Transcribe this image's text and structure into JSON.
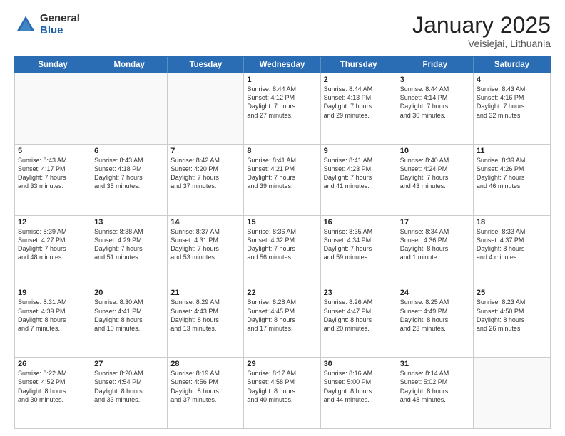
{
  "logo": {
    "general": "General",
    "blue": "Blue"
  },
  "header": {
    "month": "January 2025",
    "location": "Veisiejai, Lithuania"
  },
  "weekdays": [
    "Sunday",
    "Monday",
    "Tuesday",
    "Wednesday",
    "Thursday",
    "Friday",
    "Saturday"
  ],
  "rows": [
    [
      {
        "day": "",
        "sunrise": "",
        "sunset": "",
        "daylight": "",
        "empty": true
      },
      {
        "day": "",
        "sunrise": "",
        "sunset": "",
        "daylight": "",
        "empty": true
      },
      {
        "day": "",
        "sunrise": "",
        "sunset": "",
        "daylight": "",
        "empty": true
      },
      {
        "day": "1",
        "sunrise": "Sunrise: 8:44 AM",
        "sunset": "Sunset: 4:12 PM",
        "daylight": "Daylight: 7 hours and 27 minutes."
      },
      {
        "day": "2",
        "sunrise": "Sunrise: 8:44 AM",
        "sunset": "Sunset: 4:13 PM",
        "daylight": "Daylight: 7 hours and 29 minutes."
      },
      {
        "day": "3",
        "sunrise": "Sunrise: 8:44 AM",
        "sunset": "Sunset: 4:14 PM",
        "daylight": "Daylight: 7 hours and 30 minutes."
      },
      {
        "day": "4",
        "sunrise": "Sunrise: 8:43 AM",
        "sunset": "Sunset: 4:16 PM",
        "daylight": "Daylight: 7 hours and 32 minutes."
      }
    ],
    [
      {
        "day": "5",
        "sunrise": "Sunrise: 8:43 AM",
        "sunset": "Sunset: 4:17 PM",
        "daylight": "Daylight: 7 hours and 33 minutes."
      },
      {
        "day": "6",
        "sunrise": "Sunrise: 8:43 AM",
        "sunset": "Sunset: 4:18 PM",
        "daylight": "Daylight: 7 hours and 35 minutes."
      },
      {
        "day": "7",
        "sunrise": "Sunrise: 8:42 AM",
        "sunset": "Sunset: 4:20 PM",
        "daylight": "Daylight: 7 hours and 37 minutes."
      },
      {
        "day": "8",
        "sunrise": "Sunrise: 8:41 AM",
        "sunset": "Sunset: 4:21 PM",
        "daylight": "Daylight: 7 hours and 39 minutes."
      },
      {
        "day": "9",
        "sunrise": "Sunrise: 8:41 AM",
        "sunset": "Sunset: 4:23 PM",
        "daylight": "Daylight: 7 hours and 41 minutes."
      },
      {
        "day": "10",
        "sunrise": "Sunrise: 8:40 AM",
        "sunset": "Sunset: 4:24 PM",
        "daylight": "Daylight: 7 hours and 43 minutes."
      },
      {
        "day": "11",
        "sunrise": "Sunrise: 8:39 AM",
        "sunset": "Sunset: 4:26 PM",
        "daylight": "Daylight: 7 hours and 46 minutes."
      }
    ],
    [
      {
        "day": "12",
        "sunrise": "Sunrise: 8:39 AM",
        "sunset": "Sunset: 4:27 PM",
        "daylight": "Daylight: 7 hours and 48 minutes."
      },
      {
        "day": "13",
        "sunrise": "Sunrise: 8:38 AM",
        "sunset": "Sunset: 4:29 PM",
        "daylight": "Daylight: 7 hours and 51 minutes."
      },
      {
        "day": "14",
        "sunrise": "Sunrise: 8:37 AM",
        "sunset": "Sunset: 4:31 PM",
        "daylight": "Daylight: 7 hours and 53 minutes."
      },
      {
        "day": "15",
        "sunrise": "Sunrise: 8:36 AM",
        "sunset": "Sunset: 4:32 PM",
        "daylight": "Daylight: 7 hours and 56 minutes."
      },
      {
        "day": "16",
        "sunrise": "Sunrise: 8:35 AM",
        "sunset": "Sunset: 4:34 PM",
        "daylight": "Daylight: 7 hours and 59 minutes."
      },
      {
        "day": "17",
        "sunrise": "Sunrise: 8:34 AM",
        "sunset": "Sunset: 4:36 PM",
        "daylight": "Daylight: 8 hours and 1 minute."
      },
      {
        "day": "18",
        "sunrise": "Sunrise: 8:33 AM",
        "sunset": "Sunset: 4:37 PM",
        "daylight": "Daylight: 8 hours and 4 minutes."
      }
    ],
    [
      {
        "day": "19",
        "sunrise": "Sunrise: 8:31 AM",
        "sunset": "Sunset: 4:39 PM",
        "daylight": "Daylight: 8 hours and 7 minutes."
      },
      {
        "day": "20",
        "sunrise": "Sunrise: 8:30 AM",
        "sunset": "Sunset: 4:41 PM",
        "daylight": "Daylight: 8 hours and 10 minutes."
      },
      {
        "day": "21",
        "sunrise": "Sunrise: 8:29 AM",
        "sunset": "Sunset: 4:43 PM",
        "daylight": "Daylight: 8 hours and 13 minutes."
      },
      {
        "day": "22",
        "sunrise": "Sunrise: 8:28 AM",
        "sunset": "Sunset: 4:45 PM",
        "daylight": "Daylight: 8 hours and 17 minutes."
      },
      {
        "day": "23",
        "sunrise": "Sunrise: 8:26 AM",
        "sunset": "Sunset: 4:47 PM",
        "daylight": "Daylight: 8 hours and 20 minutes."
      },
      {
        "day": "24",
        "sunrise": "Sunrise: 8:25 AM",
        "sunset": "Sunset: 4:49 PM",
        "daylight": "Daylight: 8 hours and 23 minutes."
      },
      {
        "day": "25",
        "sunrise": "Sunrise: 8:23 AM",
        "sunset": "Sunset: 4:50 PM",
        "daylight": "Daylight: 8 hours and 26 minutes."
      }
    ],
    [
      {
        "day": "26",
        "sunrise": "Sunrise: 8:22 AM",
        "sunset": "Sunset: 4:52 PM",
        "daylight": "Daylight: 8 hours and 30 minutes."
      },
      {
        "day": "27",
        "sunrise": "Sunrise: 8:20 AM",
        "sunset": "Sunset: 4:54 PM",
        "daylight": "Daylight: 8 hours and 33 minutes."
      },
      {
        "day": "28",
        "sunrise": "Sunrise: 8:19 AM",
        "sunset": "Sunset: 4:56 PM",
        "daylight": "Daylight: 8 hours and 37 minutes."
      },
      {
        "day": "29",
        "sunrise": "Sunrise: 8:17 AM",
        "sunset": "Sunset: 4:58 PM",
        "daylight": "Daylight: 8 hours and 40 minutes."
      },
      {
        "day": "30",
        "sunrise": "Sunrise: 8:16 AM",
        "sunset": "Sunset: 5:00 PM",
        "daylight": "Daylight: 8 hours and 44 minutes."
      },
      {
        "day": "31",
        "sunrise": "Sunrise: 8:14 AM",
        "sunset": "Sunset: 5:02 PM",
        "daylight": "Daylight: 8 hours and 48 minutes."
      },
      {
        "day": "",
        "sunrise": "",
        "sunset": "",
        "daylight": "",
        "empty": true
      }
    ]
  ]
}
